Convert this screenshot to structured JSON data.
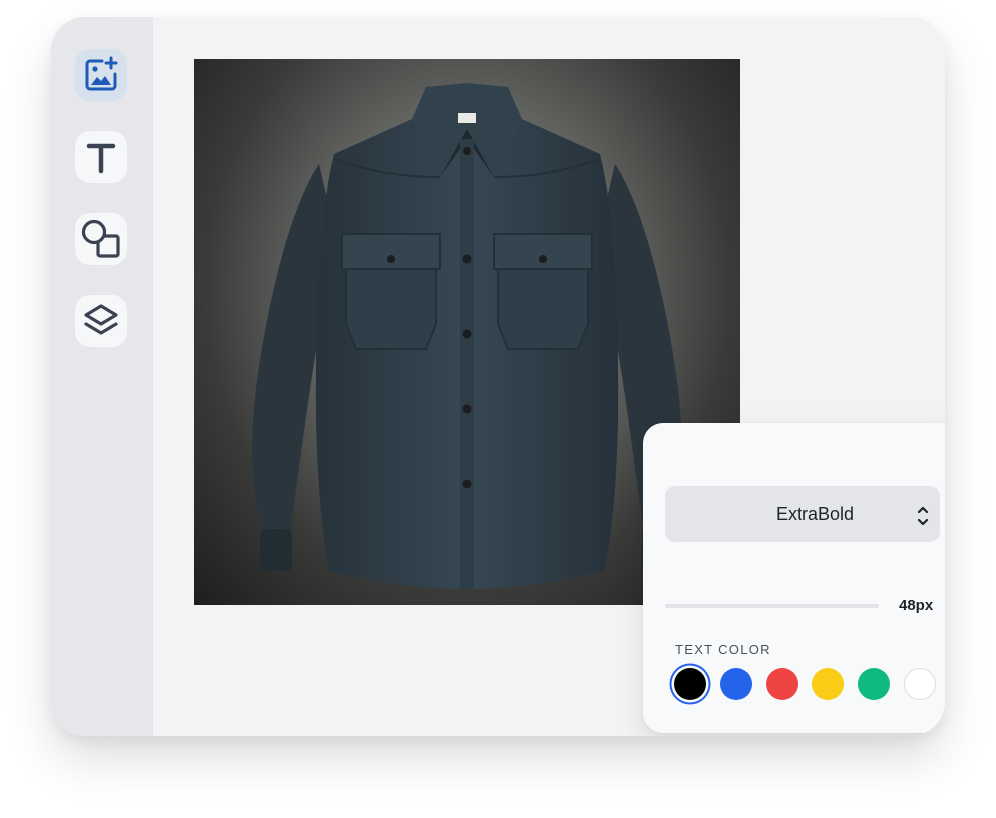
{
  "sidebar": {
    "tools": [
      {
        "name": "add-image",
        "icon": "image-plus-icon",
        "active": true
      },
      {
        "name": "text",
        "icon": "text-icon",
        "active": false
      },
      {
        "name": "shapes",
        "icon": "shapes-icon",
        "active": false
      },
      {
        "name": "layers",
        "icon": "layers-icon",
        "active": false
      }
    ]
  },
  "canvas": {
    "image_subject": "dark denim long-sleeve button-up shirt with two chest pockets"
  },
  "properties_panel": {
    "font_weight_value": "ExtraBold",
    "font_size_value": "48px",
    "text_color_label": "TEXT COLOR",
    "text_colors": [
      {
        "name": "black",
        "hex": "#000000",
        "selected": true
      },
      {
        "name": "blue",
        "hex": "#2563eb",
        "selected": false
      },
      {
        "name": "red",
        "hex": "#ef4444",
        "selected": false
      },
      {
        "name": "yellow",
        "hex": "#facc15",
        "selected": false
      },
      {
        "name": "green",
        "hex": "#10b981",
        "selected": false
      },
      {
        "name": "white",
        "hex": "#ffffff",
        "selected": false
      }
    ]
  },
  "colors": {
    "accent": "#2563eb",
    "icon": "#3b4252",
    "active_icon": "#1e5bb8"
  }
}
